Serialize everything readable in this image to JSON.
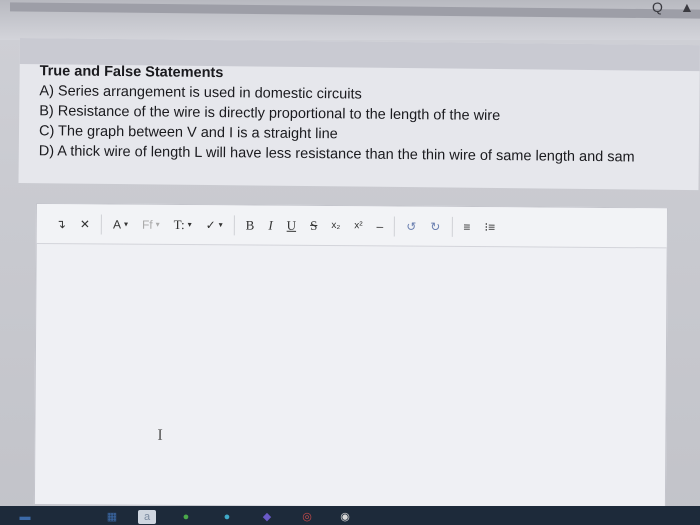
{
  "question": {
    "title": "True and False Statements",
    "statements": [
      "A) Series arrangement is used in domestic circuits",
      "B) Resistance of the wire is directly proportional to the length of the wire",
      "C) The graph between V and I is a straight line",
      "D) A thick wire of length L will have less resistance than the thin wire of same length and sam"
    ]
  },
  "toolbar": {
    "items": [
      {
        "name": "undo-icon",
        "glyph": "↴"
      },
      {
        "name": "clear-format-icon",
        "glyph": "✕"
      },
      {
        "name": "font-size-dropdown",
        "glyph": "A",
        "caret": "▾"
      },
      {
        "name": "font-family-dropdown",
        "glyph": "Ff",
        "caret": "▾"
      },
      {
        "name": "text-style-dropdown",
        "glyph": "T:",
        "caret": "▾"
      },
      {
        "name": "text-color-dropdown",
        "glyph": "✓",
        "caret": "▾"
      },
      {
        "name": "bold-button",
        "glyph": "B"
      },
      {
        "name": "italic-button",
        "glyph": "I"
      },
      {
        "name": "underline-button",
        "glyph": "U"
      },
      {
        "name": "strikethrough-button",
        "glyph": "S"
      },
      {
        "name": "subscript-button",
        "glyph": "x₂"
      },
      {
        "name": "superscript-button",
        "glyph": "x²"
      },
      {
        "name": "horizontal-rule-button",
        "glyph": "–"
      },
      {
        "name": "undo-button",
        "glyph": "↺"
      },
      {
        "name": "redo-button",
        "glyph": "↻"
      },
      {
        "name": "unordered-list-button",
        "glyph": "≡"
      },
      {
        "name": "ordered-list-button",
        "glyph": "⁝≡"
      }
    ]
  },
  "editor": {
    "cursor_glyph": "I",
    "corner_glyph": "…"
  },
  "top_glyphs": {
    "left": "Q",
    "right": "▲"
  },
  "taskbar": {
    "items": [
      {
        "name": "taskbar-item-1",
        "glyph": "▬",
        "color": "#3c6aa8"
      },
      {
        "name": "taskbar-item-2",
        "glyph": "▦",
        "color": "#3c6aa8"
      },
      {
        "name": "taskbar-item-3",
        "glyph": "a",
        "color": "#7a8aa0"
      },
      {
        "name": "taskbar-item-4",
        "glyph": "●",
        "color": "#4aa84a"
      },
      {
        "name": "taskbar-item-5",
        "glyph": "●",
        "color": "#3fa9c8"
      },
      {
        "name": "taskbar-item-6",
        "glyph": "◆",
        "color": "#6a5ac8"
      },
      {
        "name": "taskbar-item-7",
        "glyph": "◎",
        "color": "#c84a4a"
      },
      {
        "name": "taskbar-item-8",
        "glyph": "◉",
        "color": "#d8d8d8"
      }
    ]
  }
}
